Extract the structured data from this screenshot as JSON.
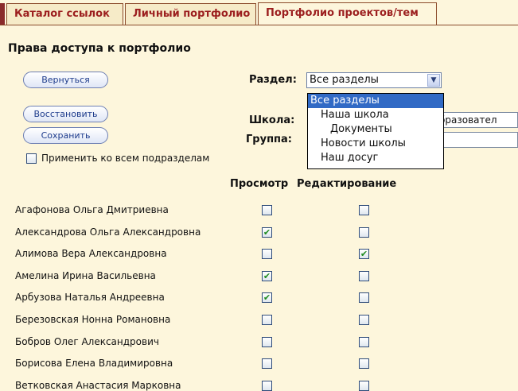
{
  "tabs": [
    "Каталог ссылок",
    "Личный портфолио",
    "Портфолио проектов/тем"
  ],
  "page_title": "Права доступа к портфолио",
  "buttons": {
    "back": "Вернуться",
    "restore": "Восстановить",
    "save": "Сохранить"
  },
  "apply_all_label": "Применить ко всем подразделам",
  "labels": {
    "section": "Раздел:",
    "school": "Школа:",
    "group": "Группа:"
  },
  "section_select": {
    "value": "Все разделы",
    "options": [
      "Все разделы",
      "Наша школа",
      "Документы",
      "Новости школы",
      "Наш досуг"
    ]
  },
  "school_value": "бразовател",
  "group_value": "",
  "columns": {
    "view": "Просмотр",
    "edit": "Редактирование"
  },
  "rows": [
    {
      "name": "Агафонова Ольга Дмитриевна",
      "view": false,
      "edit": false
    },
    {
      "name": "Александрова Ольга Александровна",
      "view": true,
      "edit": false
    },
    {
      "name": "Алимова Вера Александровна",
      "view": false,
      "edit": true
    },
    {
      "name": "Амелина Ирина Васильевна",
      "view": true,
      "edit": false
    },
    {
      "name": "Арбузова Наталья Андреевна",
      "view": true,
      "edit": false
    },
    {
      "name": "Березовская Нонна Романовна",
      "view": false,
      "edit": false
    },
    {
      "name": "Бобров Олег Александрович",
      "view": false,
      "edit": false
    },
    {
      "name": "Борисова Елена Владимировна",
      "view": false,
      "edit": false
    },
    {
      "name": "Ветковская Анастасия Марковна",
      "view": false,
      "edit": false
    }
  ],
  "colors": {
    "tab_text": "#9c1f1f",
    "tab_border": "#8a4a2a",
    "background": "#fdf6dc",
    "selection": "#316ac5",
    "check": "#1d8a1d"
  }
}
